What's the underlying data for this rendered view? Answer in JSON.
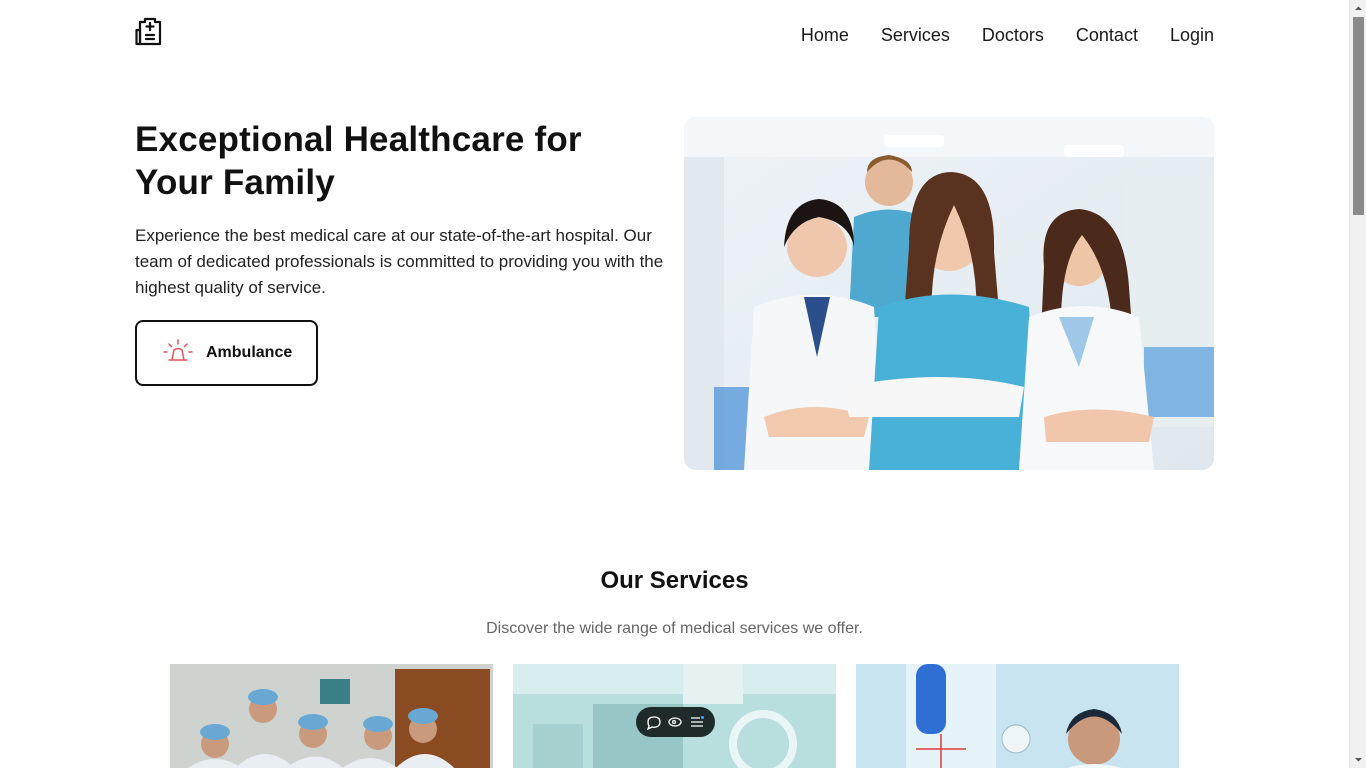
{
  "header": {
    "logo_icon": "hospital-building-icon",
    "nav": [
      "Home",
      "Services",
      "Doctors",
      "Contact",
      "Login"
    ]
  },
  "hero": {
    "title": "Exceptional Healthcare for Your Family",
    "text": "Experience the best medical care at our state-of-the-art hospital. Our team of dedicated professionals is committed to providing you with the highest quality of service.",
    "button_label": "Ambulance",
    "button_icon": "siren-icon"
  },
  "services": {
    "title": "Our Services",
    "subtitle": "Discover the wide range of medical services we offer."
  },
  "floating_toolbar": {
    "icons": [
      "comment-icon",
      "eye-icon",
      "list-icon"
    ]
  },
  "colors": {
    "accent_red": "#e05555",
    "text": "#111111",
    "muted": "#666666"
  }
}
